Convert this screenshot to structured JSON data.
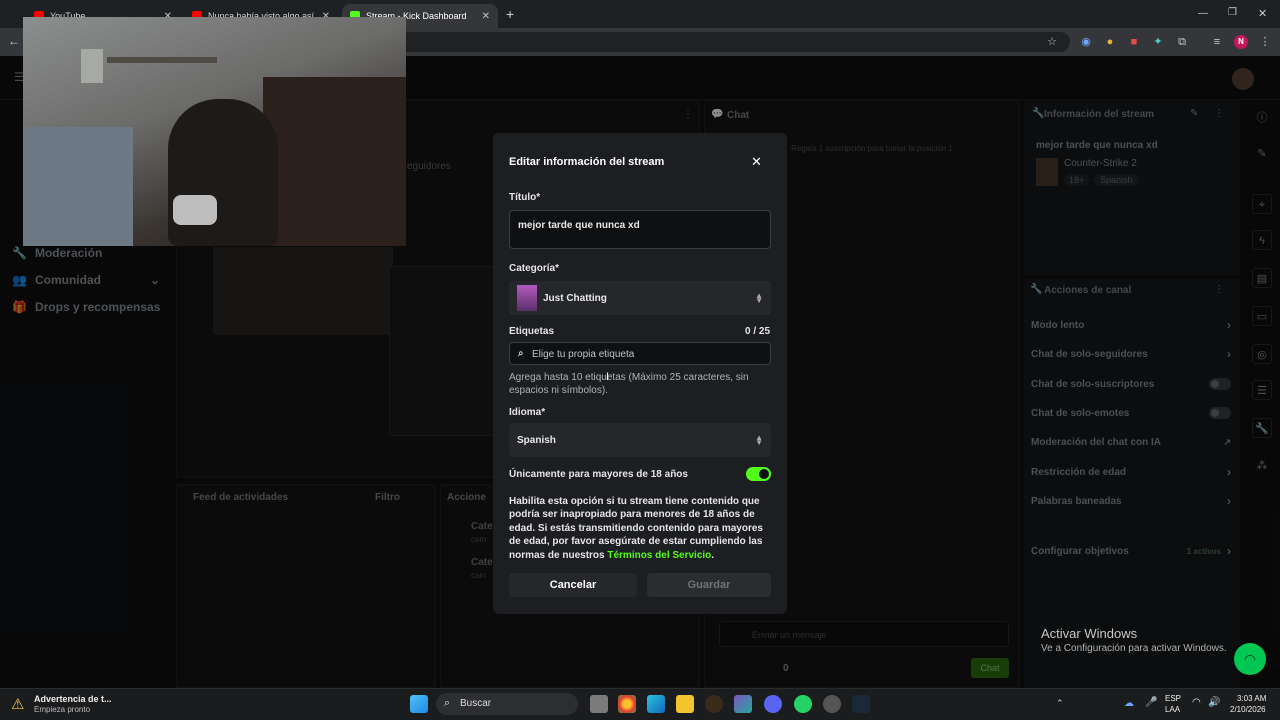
{
  "browser": {
    "tabs": [
      {
        "title": "YouTube"
      },
      {
        "title": "Nunca había visto algo así... LA"
      },
      {
        "title": "Stream - Kick Dashboard"
      }
    ],
    "new_tab": "+"
  },
  "sidebar": {
    "items": [
      {
        "label": "Moderación"
      },
      {
        "label": "Comunidad"
      },
      {
        "label": "Drops y recompensas"
      }
    ]
  },
  "background": {
    "followers_label": "eguidores",
    "chat_title": "Chat",
    "chat_subscribe_hint": "Regala 1 suscripción para tomar la posición 1",
    "activity_feed_title": "Feed de actividades",
    "activity_filter": "Filtro",
    "actions_title": "Accione",
    "feed_rows": [
      {
        "line1": "Cate",
        "line2": "cam"
      },
      {
        "line1": "Cate",
        "line2": "cam"
      }
    ],
    "chat_input_placeholder": "Enviar un mensaje",
    "chat_send_button": "Chat",
    "chat_counter": "0"
  },
  "stream_info": {
    "title": "Información del stream",
    "stream_title": "mejor tarde que nunca xd",
    "category": "Counter-Strike 2",
    "badges": [
      "18+",
      "Spanish"
    ]
  },
  "channel_actions": {
    "title": "Acciones de canal",
    "rows": [
      {
        "label": "Modo lento",
        "control": "chevron"
      },
      {
        "label": "Chat de solo-seguidores",
        "control": "chevron"
      },
      {
        "label": "Chat de solo-suscriptores",
        "control": "toggle"
      },
      {
        "label": "Chat de solo-emotes",
        "control": "toggle"
      },
      {
        "label": "Moderación del chat con IA",
        "control": "external"
      },
      {
        "label": "Restricción de edad",
        "control": "chevron"
      },
      {
        "label": "Palabras baneadas",
        "control": "chevron"
      },
      {
        "label": "Configurar objetivos",
        "control": "chevron"
      }
    ],
    "goal_status": "1 activos"
  },
  "modal": {
    "title": "Editar información del stream",
    "title_label": "Título*",
    "title_value": "mejor tarde que nunca xd",
    "category_label": "Categoría*",
    "category_value": "Just Chatting",
    "tags_label": "Etiquetas",
    "tags_count": "0 / 25",
    "tags_placeholder": "Elige tu propia etiqueta",
    "tags_hint": "Agrega hasta 10 etiquetas (Máximo 25 caracteres, sin espacios ni símbolos).",
    "language_label": "Idioma*",
    "language_value": "Spanish",
    "mature_label": "Únicamente para mayores de 18 años",
    "mature_enabled": true,
    "mature_desc": "Habilita esta opción si tu stream tiene contenido que podría ser inapropiado para menores de 18 años de edad. Si estás transmitiendo contenido para mayores de edad, por favor asegúrate de estar cumpliendo las normas de nuestros ",
    "terms_link": "Términos del Servicio",
    "terms_period": ".",
    "cancel_label": "Cancelar",
    "save_label": "Guardar"
  },
  "windows_activation": {
    "title": "Activar Windows",
    "subtitle": "Ve a Configuración para activar Windows."
  },
  "taskbar": {
    "notification_title": "Advertencia de t...",
    "notification_subtitle": "Empieza pronto",
    "search_label": "Buscar",
    "lang_top": "ESP",
    "lang_bottom": "LAA",
    "time": "3:03 AM",
    "date": "2/10/2026"
  },
  "colors": {
    "kick_green": "#53fc18",
    "modal_bg": "#1d1e21",
    "input_bg": "#0f1012"
  }
}
